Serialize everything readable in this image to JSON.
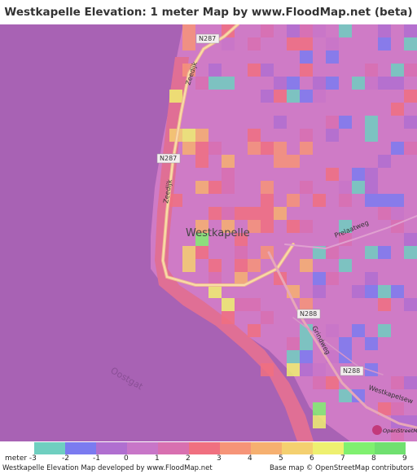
{
  "title": "Westkapelle Elevation: 1 meter Map by www.FloodMap.net (beta)",
  "map": {
    "town_label": "Westkapelle",
    "sea_label": "Oostgat",
    "roads": [
      {
        "label": "N287"
      },
      {
        "label": "N287"
      },
      {
        "label": "Zeedijk"
      },
      {
        "label": "Zeedijk"
      },
      {
        "label": "Prelaatweg"
      },
      {
        "label": "N288"
      },
      {
        "label": "Grindweg"
      },
      {
        "label": "N288"
      },
      {
        "label": "Westkapelsew"
      }
    ],
    "badge": "OpenStreetMap"
  },
  "legend": {
    "unit_label": "meter",
    "items": [
      {
        "label": "-3",
        "color": "#6fcfc0"
      },
      {
        "label": "-2",
        "color": "#7b7bf0"
      },
      {
        "label": "-1",
        "color": "#b06fd0"
      },
      {
        "label": "0",
        "color": "#c876c8"
      },
      {
        "label": "1",
        "color": "#d870b0"
      },
      {
        "label": "2",
        "color": "#f07080"
      },
      {
        "label": "3",
        "color": "#f69478"
      },
      {
        "label": "4",
        "color": "#f6b070"
      },
      {
        "label": "5",
        "color": "#f4d070"
      },
      {
        "label": "6",
        "color": "#eef070"
      },
      {
        "label": "7",
        "color": "#80f070"
      },
      {
        "label": "8",
        "color": "#70e070"
      },
      {
        "label": "9",
        "color": ""
      }
    ]
  },
  "footer": {
    "left": "Westkapelle Elevation Map developed by www.FloodMap.net",
    "right": "Base map © OpenStreetMap contributors"
  }
}
